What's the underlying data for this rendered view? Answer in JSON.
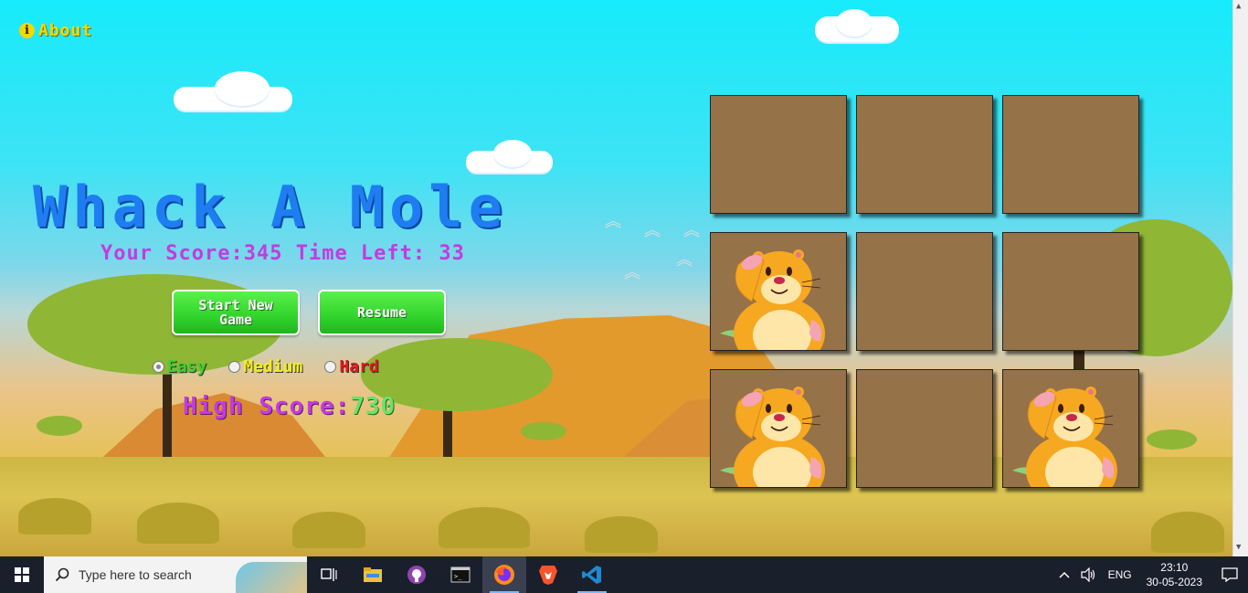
{
  "about": {
    "label": "About",
    "icon": "info-icon"
  },
  "game": {
    "title": "Whack A Mole",
    "score_label": "Your Score:",
    "score": "345",
    "time_label": "Time Left:",
    "time_left": "33",
    "buttons": {
      "start": "Start New Game",
      "resume": "Resume"
    },
    "difficulty": [
      {
        "label": "Easy",
        "selected": true,
        "color": "#3fcf2f"
      },
      {
        "label": "Medium",
        "selected": false,
        "color": "#f3ef1b"
      },
      {
        "label": "Hard",
        "selected": false,
        "color": "#e11a1a"
      }
    ],
    "high_score_label": "High Score:",
    "high_score": "730"
  },
  "grid": {
    "holes": [
      {
        "mole": false
      },
      {
        "mole": false
      },
      {
        "mole": false
      },
      {
        "mole": true
      },
      {
        "mole": false
      },
      {
        "mole": false
      },
      {
        "mole": true
      },
      {
        "mole": false
      },
      {
        "mole": true
      }
    ],
    "hole_color": "#967249"
  },
  "taskbar": {
    "search_placeholder": "Type here to search",
    "apps": [
      "task-view-icon",
      "file-explorer-icon",
      "github-desktop-icon",
      "terminal-icon",
      "firefox-icon",
      "brave-icon",
      "vscode-icon"
    ],
    "tray": {
      "language": "ENG",
      "time": "23:10",
      "date": "30-05-2023"
    }
  },
  "colors": {
    "title": "#1f7df2",
    "stats": "#c33be0",
    "button": "#31d42c",
    "sky": "#16ebfb"
  }
}
